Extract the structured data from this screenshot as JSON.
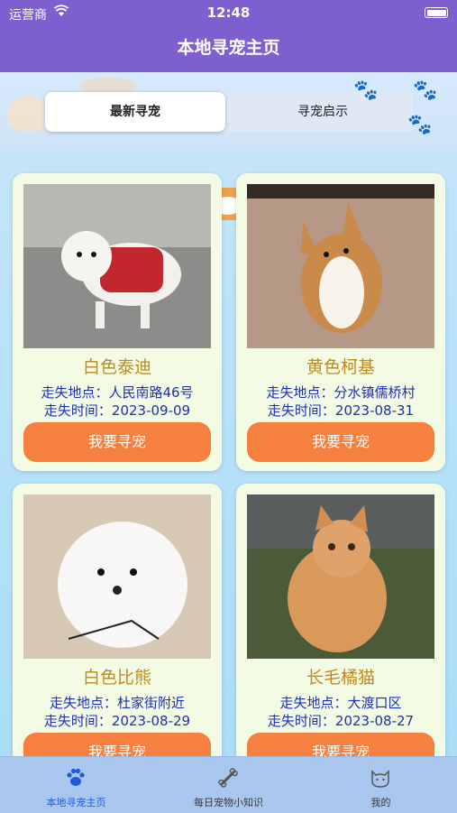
{
  "status_bar": {
    "carrier": "运营商",
    "time": "12:48"
  },
  "nav": {
    "title": "本地寻宠主页"
  },
  "tabs": [
    {
      "label": "最新寻宠",
      "active": true
    },
    {
      "label": "寻宠启示",
      "active": false
    }
  ],
  "pets": [
    {
      "name": "白色泰迪",
      "location": "走失地点：人民南路46号",
      "time": "走失时间：2023-09-09",
      "button": "我要寻宠"
    },
    {
      "name": "黄色柯基",
      "location": "走失地点：分水镇儒桥村",
      "time": "走失时间：2023-08-31",
      "button": "我要寻宠"
    },
    {
      "name": "白色比熊",
      "location": "走失地点：杜家街附近",
      "time": "走失时间：2023-08-29",
      "button": "我要寻宠"
    },
    {
      "name": "长毛橘猫",
      "location": "走失地点：大渡口区",
      "time": "走失时间：2023-08-27",
      "button": "我要寻宠"
    }
  ],
  "tab_bar": [
    {
      "label": "本地寻宠主页",
      "icon": "paw-icon",
      "active": true
    },
    {
      "label": "每日宠物小知识",
      "icon": "bone-icon",
      "active": false
    },
    {
      "label": "我的",
      "icon": "cat-face-icon",
      "active": false
    }
  ],
  "colors": {
    "header": "#7d5fd0",
    "button": "#f5803f",
    "pet_name": "#c08a1b",
    "info_text": "#1c2fb6",
    "active_tab": "#1d5bd8"
  }
}
